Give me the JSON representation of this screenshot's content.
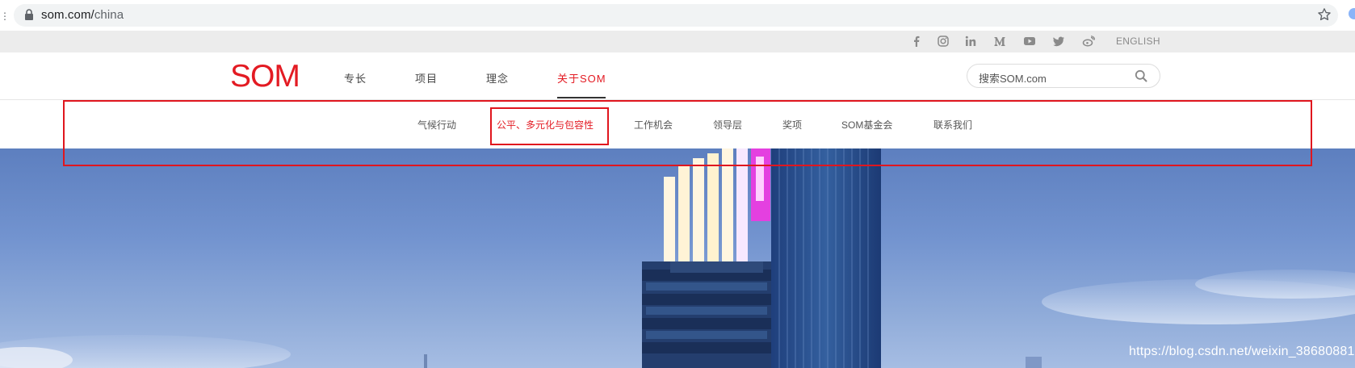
{
  "browser": {
    "url_host": "som.com/",
    "url_path": "china",
    "bookmark_icon": "star-icon",
    "lock_icon": "lock-icon"
  },
  "utility_bar": {
    "social_icons": [
      "facebook-icon",
      "instagram-icon",
      "linkedin-icon",
      "medium-icon",
      "youtube-icon",
      "twitter-icon",
      "weibo-icon"
    ],
    "language_link": "ENGLISH"
  },
  "header": {
    "logo": "SOM",
    "brand_color": "#e31b23",
    "nav": [
      {
        "label": "专长",
        "active": false
      },
      {
        "label": "项目",
        "active": false
      },
      {
        "label": "理念",
        "active": false
      },
      {
        "label": "关于SOM",
        "active": true
      }
    ],
    "search_placeholder": "搜索SOM.com"
  },
  "sub_nav": {
    "items": [
      {
        "label": "气候行动",
        "active": false
      },
      {
        "label": "公平、多元化与包容性",
        "active": true
      },
      {
        "label": "工作机会",
        "active": false
      },
      {
        "label": "领导层",
        "active": false
      },
      {
        "label": "奖项",
        "active": false
      },
      {
        "label": "SOM基金会",
        "active": false
      },
      {
        "label": "联系我们",
        "active": false
      }
    ]
  },
  "watermark": "https://blog.csdn.net/weixin_38680881",
  "annotation_color": "#e0161e"
}
